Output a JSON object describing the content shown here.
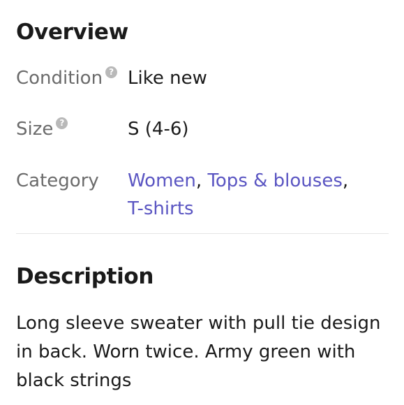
{
  "overview": {
    "title": "Overview",
    "condition": {
      "label": "Condition",
      "value": "Like new",
      "help_icon": "question-circle-icon"
    },
    "size": {
      "label": "Size",
      "value": "S (4-6)",
      "help_icon": "question-circle-icon"
    },
    "category": {
      "label": "Category",
      "links": [
        "Women",
        "Tops & blouses",
        "T-shirts"
      ],
      "separator": ","
    }
  },
  "description": {
    "title": "Description",
    "text": "Long sleeve sweater with pull tie design in back. Worn twice. Army green with black strings"
  },
  "colors": {
    "link": "#5a55c2",
    "label": "#6b6b6b",
    "text": "#1a1a1a",
    "divider": "#e4e4e4",
    "help_icon_bg": "#b9b9b9"
  }
}
